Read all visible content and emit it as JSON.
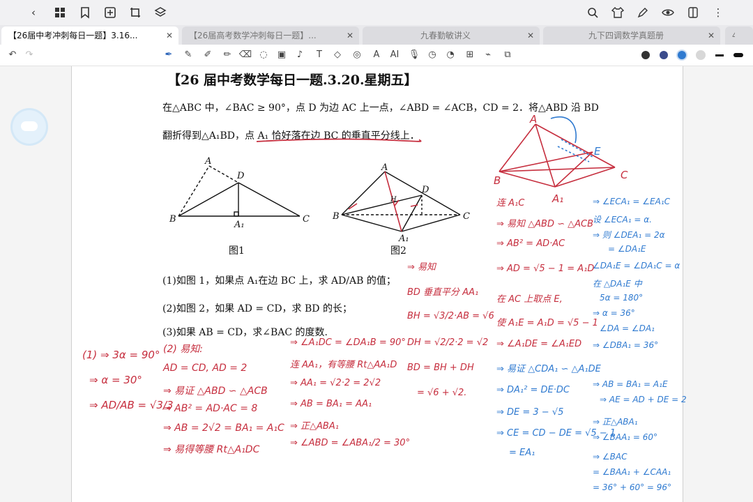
{
  "tabs": [
    {
      "label": "【26届中考冲刺每日一题】3.16...",
      "active": true
    },
    {
      "label": "【26届高考数学冲刺每日一题】...",
      "active": false
    },
    {
      "label": "九春勤敏讲义",
      "active": false
    },
    {
      "label": "九下四调数学真题册",
      "active": false
    },
    {
      "label": "4",
      "active": false
    }
  ],
  "topbar_icons": [
    "back-icon",
    "grid-icon",
    "bookmark-icon",
    "add-page-icon",
    "crop-icon",
    "layers-icon",
    "search-icon",
    "shirt-icon",
    "pen-edit-icon",
    "eye-icon",
    "split-icon",
    "more-icon"
  ],
  "toolbar_icons": [
    "pen-icon",
    "pencil-icon",
    "marker-icon",
    "highlighter-icon",
    "eraser-icon",
    "lasso-icon",
    "image-icon",
    "music-icon",
    "textbox-icon",
    "shape-icon",
    "text-icon",
    "ai-icon",
    "mic-icon",
    "timer-icon",
    "sticker-icon",
    "ruler-icon",
    "laser-icon",
    "screenshot-icon"
  ],
  "colors": {
    "ink_red": "#c62e3e",
    "ink_blue": "#2f7ad0",
    "active_tab": "#ffffff"
  },
  "document": {
    "title": "【26 届中考数学每日一题.3.20.星期五】",
    "problem_line1": "在△ABC 中，∠BAC ≥ 90°，点 D 为边 AC 上一点，∠ABD = ∠ACB，CD = 2．将△ABD 沿 BD",
    "problem_line2": "翻折得到△A₁BD，点 A₁ 恰好落在边 BC 的垂直平分线上．",
    "fig1_caption": "图1",
    "fig2_caption": "图2",
    "q1": "(1)如图 1，如果点 A₁在边 BC 上，求 AD/AB 的值；",
    "q2": "(2)如图 2，如果 AD = CD，求 BD 的长；",
    "q3": "(3)如果 AB = CD，求∠BAC 的度数."
  },
  "fig1_labels": {
    "A": "A",
    "B": "B",
    "C": "C",
    "D": "D",
    "A1": "A₁"
  },
  "fig2_labels": {
    "A": "A",
    "B": "B",
    "C": "C",
    "D": "D",
    "A1": "A₁",
    "H": "H"
  },
  "handwriting_red": [
    "(1) ⇒ 3α = 90°",
    "⇒ α = 30°",
    "⇒ AD/AB = √3/3",
    "(2) 易知:",
    "AD = CD, AD = 2",
    "⇒ 易证 △ABD ∽ △ACB",
    "⇒ AB² = AD·AC = 8",
    "⇒ AB = 2√2 = BA₁ = A₁C",
    "⇒ 易得等腰 Rt△A₁DC",
    "⇒ ∠A₁DC = ∠DA₁B = 90°",
    "连 AA₁，有等腰 Rt△AA₁D",
    "⇒ AA₁ = √2·2 = 2√2",
    "⇒ AB = BA₁ = AA₁",
    "⇒ 正△ABA₁",
    "⇒ ∠ABD = ∠ABA₁/2 = 30°",
    "⇒ 易知",
    "BD 垂直平分 AA₁",
    "BH = √3/2·AB = √6",
    "DH = √2/2·2 = √2",
    "BD = BH + DH",
    "= √6 + √2.",
    "连 A₁C",
    "⇒ 易知 △ABD ∽ △ACB",
    "⇒ AB² = AD·AC",
    "⇒ AD = √5 − 1 = A₁D",
    "在 AC 上取点 E,",
    "使 A₁E = A₁D = √5 − 1",
    "⇒ ∠A₁DE = ∠A₁ED",
    "⇒ 易证 △CDA₁ ∽ △A₁DE",
    "⇒ DA₁² = DE·DC",
    "⇒ DE = 3 − √5",
    "⇒ CE = CD − DE = √5 − 1",
    "= EA₁"
  ],
  "handwriting_blue": [
    "⇒ ∠ECA₁ = ∠EA₁C",
    "设 ∠ECA₁ = α.",
    "⇒ 则 ∠DEA₁ = 2α",
    "= ∠DA₁E",
    "∠DA₁E = ∠DA₁C = α",
    "在 △DA₁E 中",
    "5α = 180°",
    "⇒ α = 36°",
    "∠DA = ∠DA₁",
    "⇒ ∠DBA₁ = 36°",
    "⇒ AB = BA₁ = A₁E",
    "⇒ AE = AD + DE = 2",
    "⇒ 正△ABA₁",
    "⇒ ∠BAA₁ = 60°",
    "⇒ ∠BAC",
    "= ∠BAA₁ + ∠CAA₁",
    "= 36° + 60° = 96°"
  ],
  "sketch_labels": {
    "A": "A",
    "B": "B",
    "C": "C",
    "A1": "A₁",
    "E": "E"
  }
}
